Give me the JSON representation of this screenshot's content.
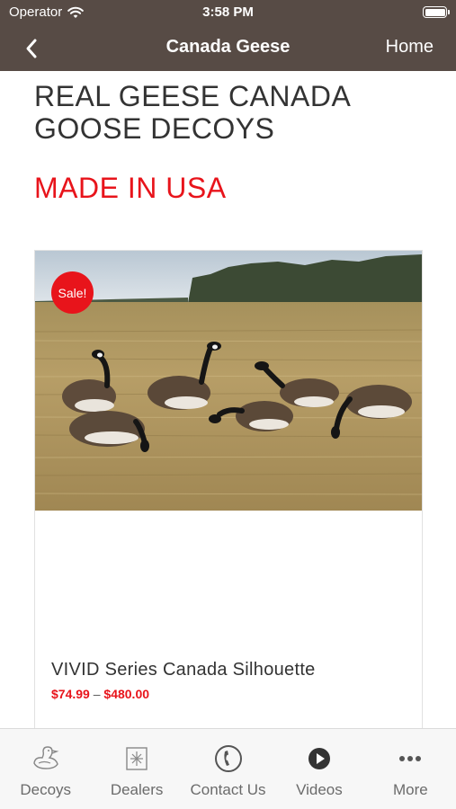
{
  "status_bar": {
    "carrier": "Operator",
    "time": "3:58 PM"
  },
  "nav": {
    "title": "Canada Geese",
    "home_label": "Home"
  },
  "content": {
    "heading": "REAL GEESE CANADA GOOSE DECOYS",
    "made_in": "MADE IN USA",
    "product": {
      "badge": "Sale!",
      "title": "VIVID Series Canada Silhouette",
      "price_low": "$74.99",
      "price_sep": "–",
      "price_high": "$480.00"
    }
  },
  "tabs": [
    {
      "label": "Decoys",
      "icon": "duck-decoy-icon"
    },
    {
      "label": "Dealers",
      "icon": "dealer-sign-icon"
    },
    {
      "label": "Contact Us",
      "icon": "phone-icon"
    },
    {
      "label": "Videos",
      "icon": "play-icon"
    },
    {
      "label": "More",
      "icon": "more-dots-icon"
    }
  ],
  "colors": {
    "header": "#574b45",
    "accent_red": "#e8141b",
    "text": "#333333",
    "tab_bg": "#f7f7f7"
  }
}
